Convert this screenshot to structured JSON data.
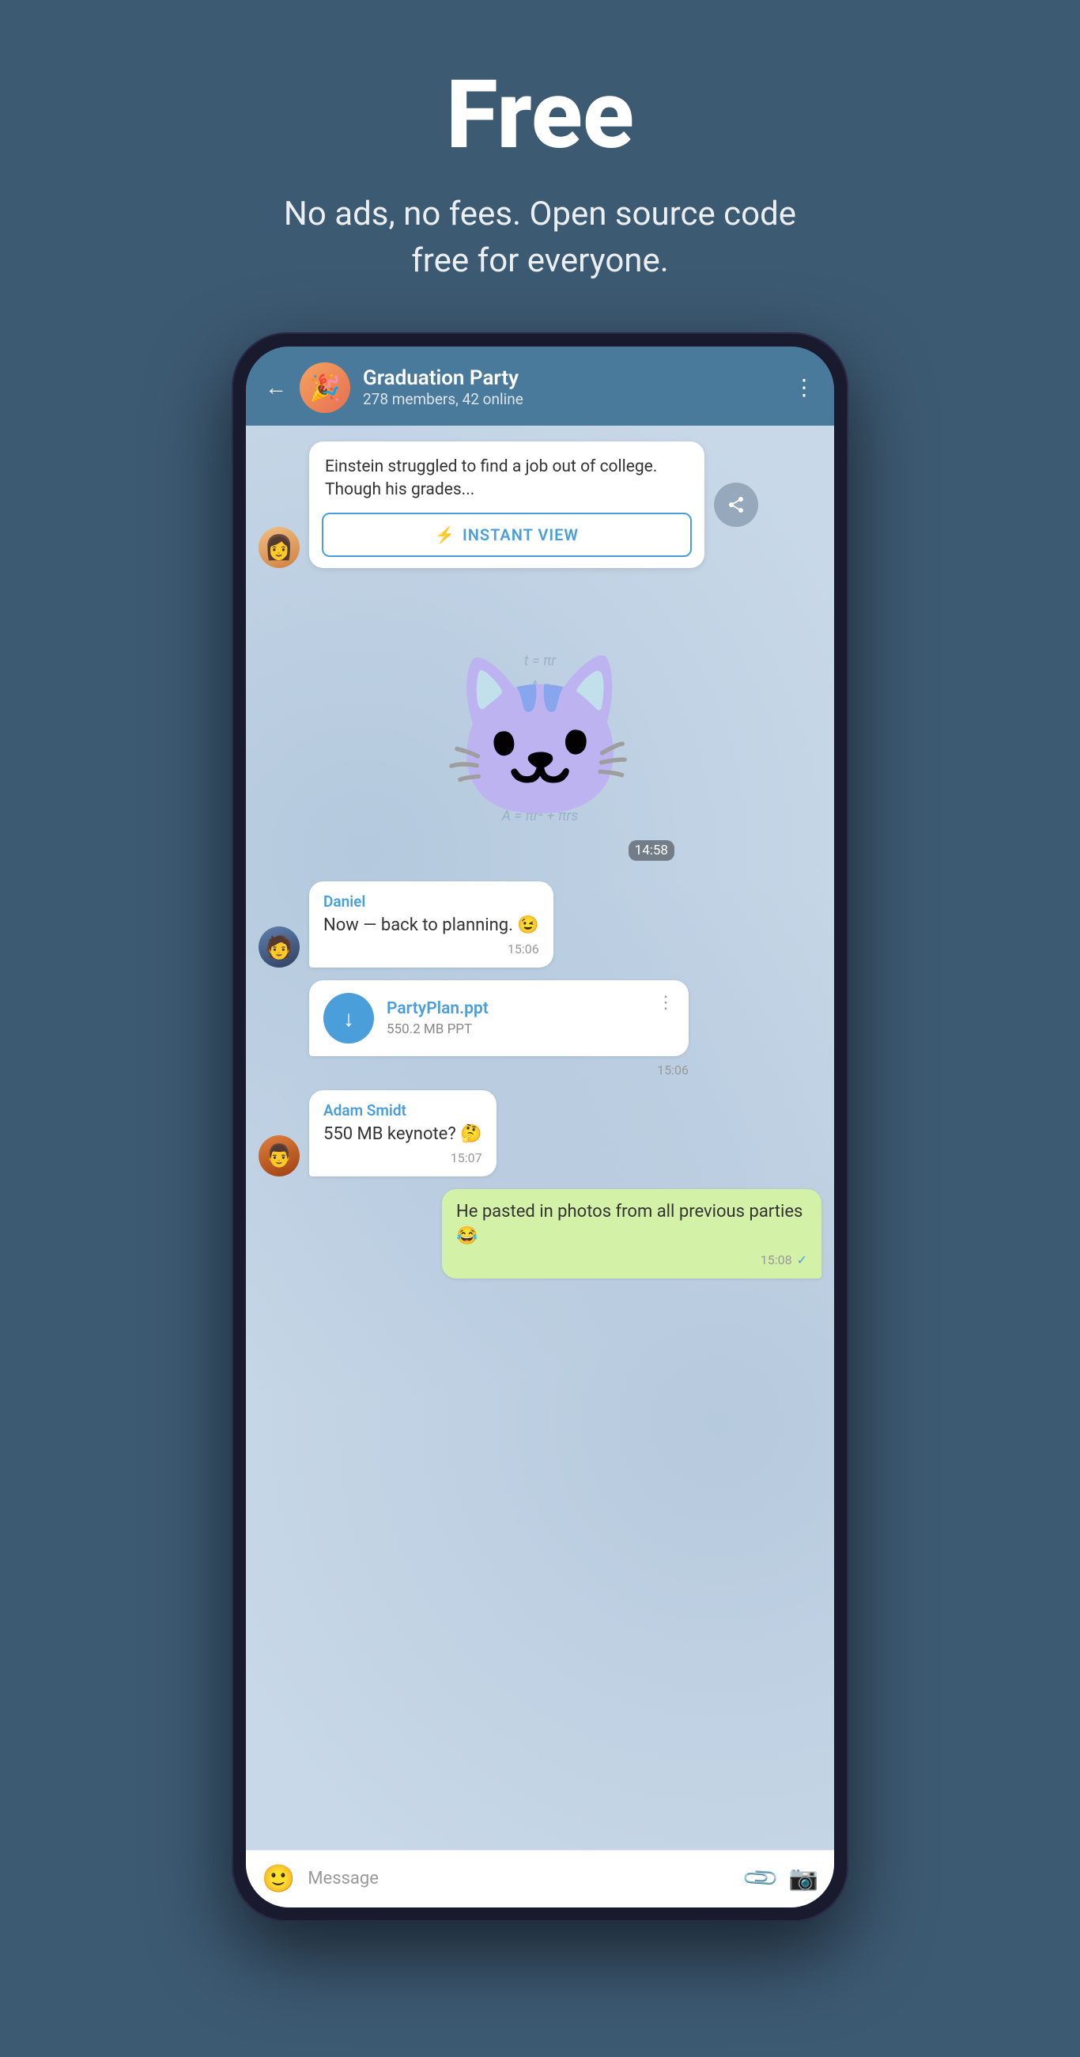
{
  "hero": {
    "title": "Free",
    "subtitle": "No ads, no fees. Open source code free for everyone."
  },
  "chat": {
    "header": {
      "group_name": "Graduation Party",
      "group_meta": "278 members, 42 online",
      "back_label": "←",
      "more_label": "⋮"
    },
    "article": {
      "text": "Einstein struggled to find a job out of college. Though his grades...",
      "instant_view_label": "INSTANT VIEW"
    },
    "sticker": {
      "time": "14:58"
    },
    "messages": [
      {
        "sender": "Daniel",
        "text": "Now — back to planning. 😉",
        "time": "15:06",
        "own": false,
        "avatar": "male-blue"
      }
    ],
    "file": {
      "name": "PartyPlan.ppt",
      "size": "550.2 MB PPT",
      "time": "15:06"
    },
    "msg_adam": {
      "sender": "Adam Smidt",
      "text": "550 MB keynote? 🤔",
      "time": "15:07",
      "avatar": "male-orange"
    },
    "msg_own": {
      "text": "He pasted in photos from all previous parties 😂",
      "time": "15:08",
      "tick": "✓"
    },
    "input": {
      "placeholder": "Message"
    }
  }
}
